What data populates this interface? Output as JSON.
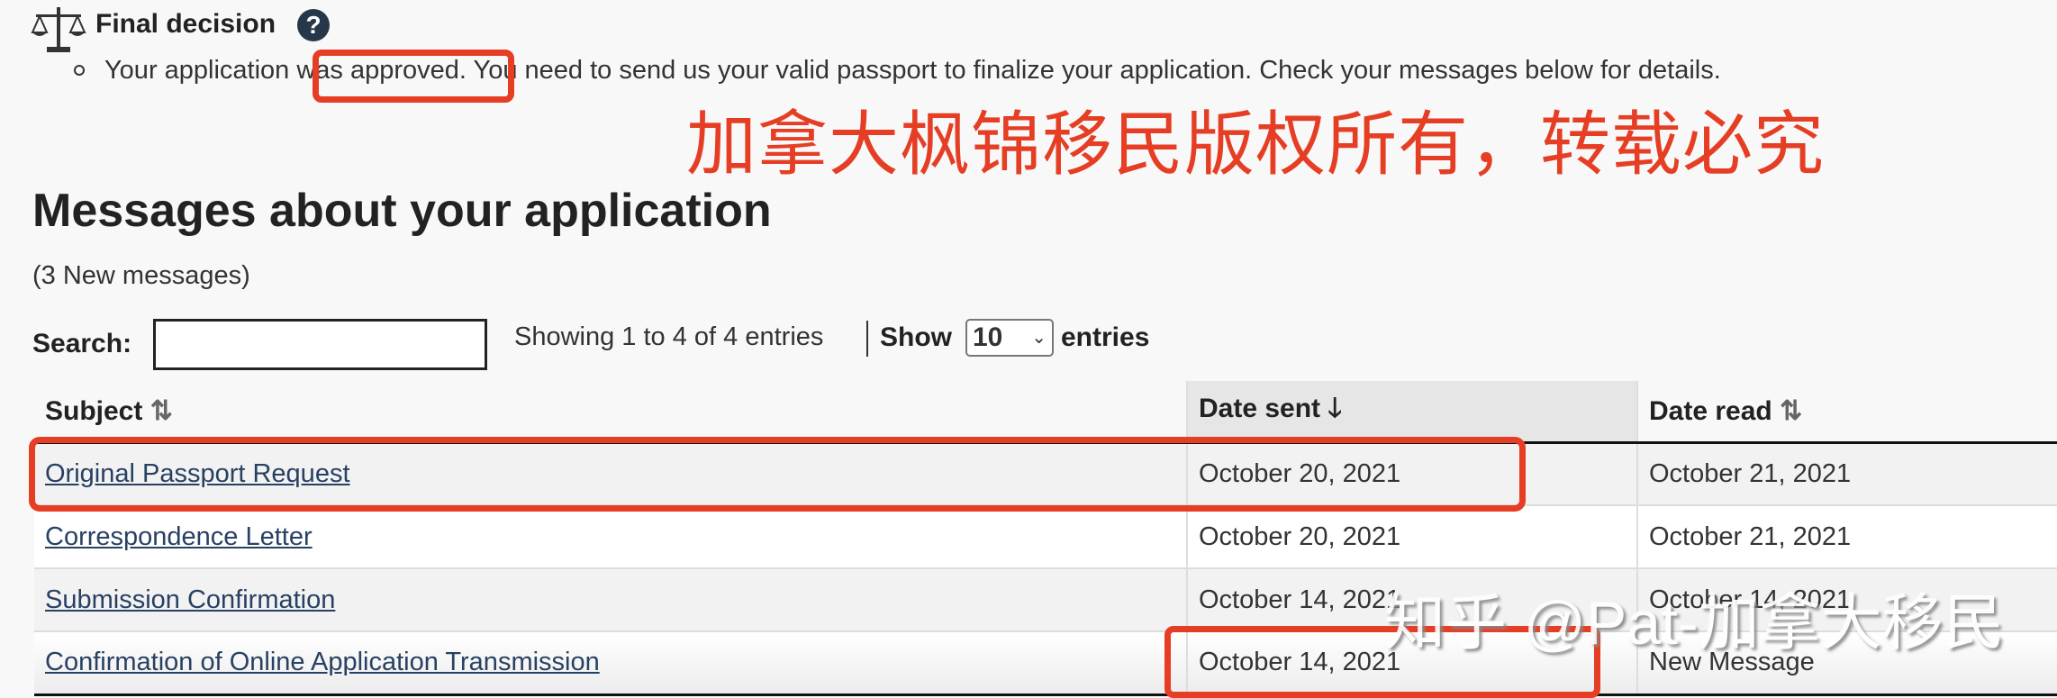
{
  "final_decision": {
    "title": "Final decision",
    "help_icon": "question-circle-icon",
    "text": "Your application was approved. You need to send us your valid passport to finalize your application. Check your messages below for details."
  },
  "annotation": {
    "text": "加拿大枫锦移民版权所有，转载必究",
    "color": "#e53e24"
  },
  "messages": {
    "title": "Messages about your application",
    "new_count": "(3 New messages)",
    "search_label": "Search:",
    "search_value": "",
    "showing": "Showing 1 to 4 of 4 entries",
    "show_label": "Show",
    "show_value": "10",
    "entries_label": "entries",
    "columns": [
      {
        "label": "Subject",
        "sort": "⇅"
      },
      {
        "label": "Date sent",
        "sort": "🡓"
      },
      {
        "label": "Date read",
        "sort": "⇅"
      }
    ],
    "rows": [
      {
        "subject": "Original Passport Request",
        "sent": "October 20, 2021",
        "read": "October 21, 2021"
      },
      {
        "subject": "Correspondence Letter",
        "sent": "October 20, 2021",
        "read": "October 21, 2021"
      },
      {
        "subject": "Submission Confirmation",
        "sent": "October 14, 2021",
        "read": "October 14, 2021"
      },
      {
        "subject": "Confirmation of Online Application Transmission",
        "sent": "October 14, 2021",
        "read": "New Message"
      }
    ]
  },
  "watermark": "知乎 @Pat-加拿大移民",
  "colors": {
    "link": "#284162",
    "highlight": "#e53e24"
  }
}
